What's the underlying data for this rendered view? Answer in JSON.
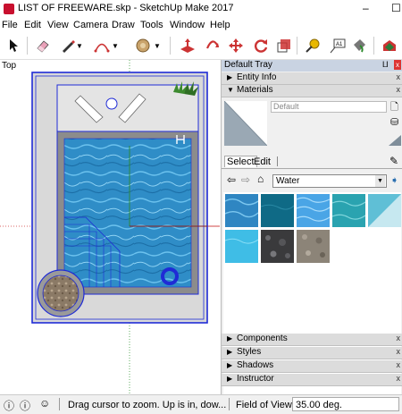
{
  "window": {
    "title": "LIST OF FREEWARE.skp - SketchUp Make 2017",
    "minimize": "–",
    "maximize": "☐"
  },
  "menus": [
    "File",
    "Edit",
    "View",
    "Camera",
    "Draw",
    "Tools",
    "Window",
    "Help"
  ],
  "viewport": {
    "scene_label": "Top"
  },
  "tray": {
    "title": "Default Tray",
    "pin": "⨿",
    "close": "x",
    "entity_info": "Entity Info",
    "materials": "Materials",
    "material_name": "Default",
    "tab_select": "Select",
    "tab_edit": "Edit",
    "library": "Water",
    "components": "Components",
    "styles": "Styles",
    "shadows": "Shadows",
    "instructor": "Instructor",
    "panel_close": "x"
  },
  "status": {
    "hint": "Drag cursor to zoom.  Up is in, dow...",
    "fov_label": "Field of View",
    "fov_value": "35.00 deg."
  },
  "colors": {
    "selection": "#1f2bd6",
    "water": "#2f8dc7",
    "water_light": "#58b5e4",
    "deck": "#d9d9d9",
    "coping": "#8c8c8c"
  },
  "icons": [
    "select-arrow-icon",
    "eraser-icon",
    "pencil-icon",
    "arc-icon",
    "push-pull-icon",
    "orbit-icon",
    "move-icon",
    "rotate-icon",
    "scale-icon",
    "tape-measure-icon",
    "text-icon",
    "paint-bucket-icon",
    "warehouse-icon"
  ]
}
